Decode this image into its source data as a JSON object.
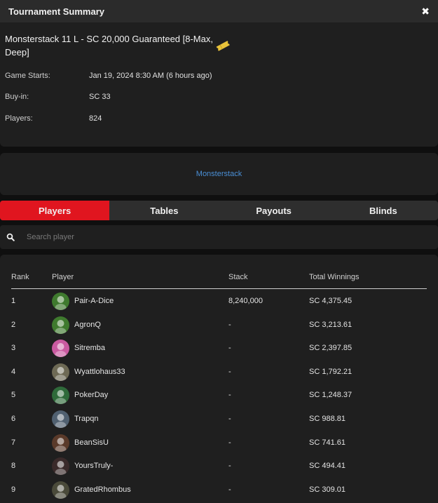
{
  "window": {
    "title": "Tournament Summary",
    "close_symbol": "✖"
  },
  "tournament": {
    "name": "Monsterstack 11 L - SC 20,000 Guaranteed [8-Max, Deep]",
    "ticket_icon": "ticket-icon",
    "details": [
      {
        "label": "Game Starts:",
        "value": "Jan 19, 2024 8:30 AM (6 hours ago)"
      },
      {
        "label": "Buy-in:",
        "value": "SC 33"
      },
      {
        "label": "Players:",
        "value": "824"
      }
    ]
  },
  "series_link": "Monsterstack",
  "tabs": [
    {
      "label": "Players",
      "active": true
    },
    {
      "label": "Tables",
      "active": false
    },
    {
      "label": "Payouts",
      "active": false
    },
    {
      "label": "Blinds",
      "active": false
    }
  ],
  "search": {
    "placeholder": "Search player",
    "value": "",
    "icon": "search-icon"
  },
  "table": {
    "headers": {
      "rank": "Rank",
      "player": "Player",
      "stack": "Stack",
      "winnings": "Total Winnings"
    },
    "rows": [
      {
        "rank": "1",
        "player": "Pair-A-Dice",
        "stack": "8,240,000",
        "winnings": "SC 4,375.45",
        "avatar": "dragon-avatar"
      },
      {
        "rank": "2",
        "player": "AgronQ",
        "stack": "-",
        "winnings": "SC 3,213.61",
        "avatar": "dragon-avatar"
      },
      {
        "rank": "3",
        "player": "Sitremba",
        "stack": "-",
        "winnings": "SC 2,397.85",
        "avatar": "character-avatar"
      },
      {
        "rank": "4",
        "player": "Wyattlohaus33",
        "stack": "-",
        "winnings": "SC 1,792.21",
        "avatar": "character-avatar"
      },
      {
        "rank": "5",
        "player": "PokerDay",
        "stack": "-",
        "winnings": "SC 1,248.37",
        "avatar": "banana-avatar"
      },
      {
        "rank": "6",
        "player": "Trapqn",
        "stack": "-",
        "winnings": "SC 988.81",
        "avatar": "panda-avatar"
      },
      {
        "rank": "7",
        "player": "BeanSisU",
        "stack": "-",
        "winnings": "SC 741.61",
        "avatar": "person-avatar"
      },
      {
        "rank": "8",
        "player": "YoursTruly-",
        "stack": "-",
        "winnings": "SC 494.41",
        "avatar": "person-avatar"
      },
      {
        "rank": "9",
        "player": "GratedRhombus",
        "stack": "-",
        "winnings": "SC 309.01",
        "avatar": "creature-avatar"
      }
    ]
  },
  "colors": {
    "accent": "#e0151f",
    "link": "#4a8fd6",
    "ticket": "#e8c23a",
    "avatar_backgrounds": [
      "#3f7a2e",
      "#3f7a2e",
      "#c95aa0",
      "#6e6a55",
      "#2f6a3a",
      "#506070",
      "#5a3a2a",
      "#3a2a2a",
      "#4a4a3a"
    ]
  }
}
